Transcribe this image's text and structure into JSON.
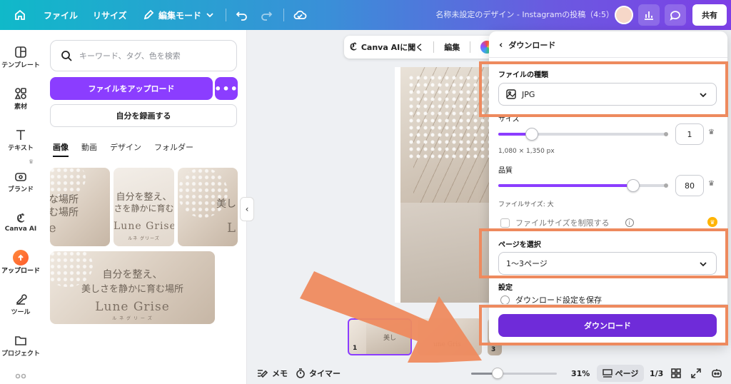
{
  "topbar": {
    "file": "ファイル",
    "resize": "リサイズ",
    "edit_mode": "編集モード",
    "document_title": "名称未設定のデザイン - Instagramの投稿（4:5）",
    "share": "共有"
  },
  "rail": {
    "items": [
      {
        "label": "テンプレート",
        "icon": "template-icon"
      },
      {
        "label": "素材",
        "icon": "elements-icon"
      },
      {
        "label": "テキスト",
        "icon": "text-icon"
      },
      {
        "label": "ブランド",
        "icon": "brand-icon"
      },
      {
        "label": "Canva AI",
        "icon": "canva-ai-icon"
      },
      {
        "label": "アップロード",
        "icon": "upload-icon"
      },
      {
        "label": "ツール",
        "icon": "tools-icon"
      },
      {
        "label": "プロジェクト",
        "icon": "folder-icon"
      }
    ]
  },
  "panel": {
    "search_placeholder": "キーワード、タグ、色を検索",
    "upload_button": "ファイルをアップロード",
    "more_button": "•••",
    "record_button": "自分を録画する",
    "tabs": [
      "画像",
      "動画",
      "デザイン",
      "フォルダー"
    ],
    "active_tab": 0,
    "thumbs": {
      "t1": {
        "line1": "な場所",
        "line2": "む場所",
        "brand": "e"
      },
      "t2": {
        "line1": "自分を整え、",
        "line2": "さを静かに育む",
        "brand": "Lune Grise",
        "sub": "ルネ グリーズ"
      },
      "t3": {
        "line1": "美し",
        "brand": "L"
      },
      "t4": {
        "line1": "自分を整え、",
        "line2": "美しさを静かに育む場所",
        "brand": "Lune Grise",
        "sub": "ル ネ グ リ ー ズ"
      }
    }
  },
  "canvas": {
    "quick_ai": "Canva AIに聞く",
    "quick_edit": "編集",
    "pages": [
      {
        "num": "1",
        "caption": "美し"
      },
      {
        "num": "2",
        "caption": "une Gris"
      },
      {
        "num": "3",
        "caption": ""
      }
    ]
  },
  "bottombar": {
    "memo": "メモ",
    "timer": "タイマー",
    "zoom": "31%",
    "zoom_level": 0.31,
    "pages": "ページ",
    "page_count": "1/3"
  },
  "download": {
    "title": "ダウンロード",
    "file_type_label": "ファイルの種類",
    "file_type_value": "JPG",
    "size_label": "サイズ",
    "size_value": "1",
    "size_fraction": 0.2,
    "dimensions": "1,080 × 1,350 px",
    "quality_label": "品質",
    "quality_value": "80",
    "quality_fraction": 0.8,
    "file_size": "ファイルサイズ: 大",
    "limit_size": "ファイルサイズを制限する",
    "page_select_label": "ページを選択",
    "page_select_value": "1〜3ページ",
    "settings_label": "設定",
    "save_settings": "ダウンロード設定を保存",
    "download_button": "ダウンロード"
  },
  "colors": {
    "accent": "#8b3dff",
    "download_button": "#6f2bd9",
    "highlight": "#ee8a5e"
  }
}
